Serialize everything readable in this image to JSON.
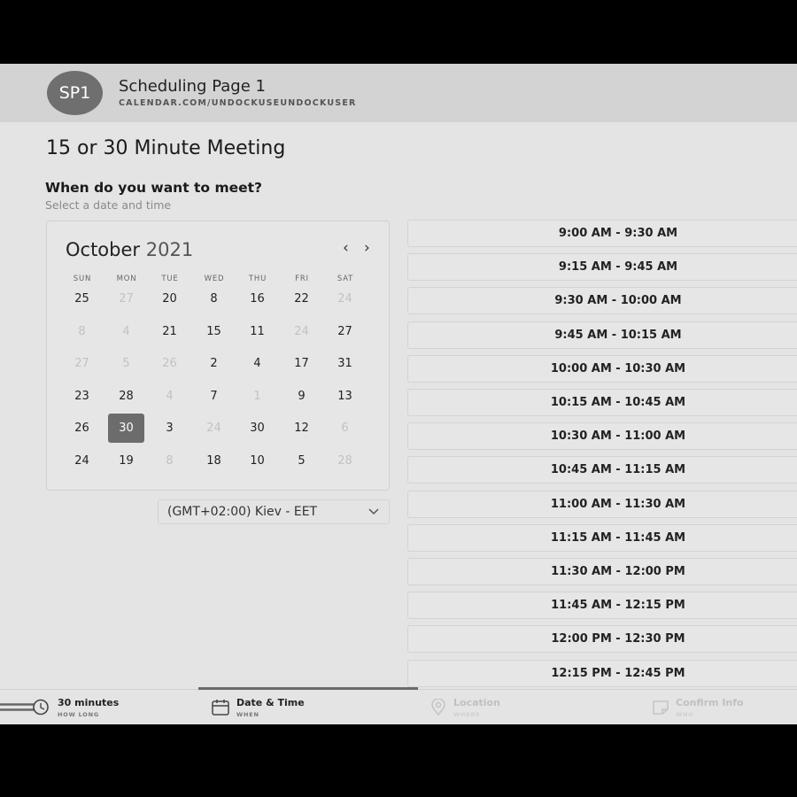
{
  "header": {
    "avatar_initials": "SP1",
    "page_name": "Scheduling Page 1",
    "page_url": "CALENDAR.COM/UNDOCKUSEUNDOCKUSER"
  },
  "meeting": {
    "title": "15 or 30 Minute Meeting",
    "question": "When do you want to meet?",
    "hint": "Select a date and time"
  },
  "calendar": {
    "month": "October",
    "year": "2021",
    "prev_icon": "‹",
    "next_icon": "›",
    "weekdays": [
      "SUN",
      "MON",
      "TUE",
      "WED",
      "THU",
      "FRI",
      "SAT"
    ],
    "weeks": [
      [
        {
          "d": "25"
        },
        {
          "d": "27",
          "muted": true
        },
        {
          "d": "20"
        },
        {
          "d": "8"
        },
        {
          "d": "16"
        },
        {
          "d": "22"
        },
        {
          "d": "24",
          "muted": true
        }
      ],
      [
        {
          "d": "8",
          "muted": true
        },
        {
          "d": "4",
          "muted": true
        },
        {
          "d": "21"
        },
        {
          "d": "15"
        },
        {
          "d": "11"
        },
        {
          "d": "24",
          "muted": true
        },
        {
          "d": "27"
        }
      ],
      [
        {
          "d": "27",
          "muted": true
        },
        {
          "d": "5",
          "muted": true
        },
        {
          "d": "26",
          "muted": true
        },
        {
          "d": "2"
        },
        {
          "d": "4"
        },
        {
          "d": "17"
        },
        {
          "d": "31"
        }
      ],
      [
        {
          "d": "23"
        },
        {
          "d": "28"
        },
        {
          "d": "4",
          "muted": true
        },
        {
          "d": "7"
        },
        {
          "d": "1",
          "muted": true
        },
        {
          "d": "9"
        },
        {
          "d": "13"
        }
      ],
      [
        {
          "d": "26"
        },
        {
          "d": "30",
          "selected": true
        },
        {
          "d": "3"
        },
        {
          "d": "24",
          "muted": true
        },
        {
          "d": "30"
        },
        {
          "d": "12"
        },
        {
          "d": "6",
          "muted": true
        }
      ],
      [
        {
          "d": "24"
        },
        {
          "d": "19"
        },
        {
          "d": "8",
          "muted": true
        },
        {
          "d": "18"
        },
        {
          "d": "10"
        },
        {
          "d": "5"
        },
        {
          "d": "28",
          "muted": true
        }
      ]
    ]
  },
  "timezone": {
    "label": "(GMT+02:00) Kiev - EET",
    "icon": "chevron-down-icon"
  },
  "time_slots": [
    "9:00 AM - 9:30 AM",
    "9:15 AM - 9:45 AM",
    "9:30 AM - 10:00 AM",
    "9:45 AM - 10:15 AM",
    "10:00 AM - 10:30 AM",
    "10:15 AM - 10:45 AM",
    "10:30 AM - 11:00 AM",
    "10:45 AM - 11:15 AM",
    "11:00 AM - 11:30 AM",
    "11:15 AM - 11:45 AM",
    "11:30 AM - 12:00 PM",
    "11:45 AM - 12:15 PM",
    "12:00 PM - 12:30 PM",
    "12:15 PM - 12:45 PM"
  ],
  "steps": [
    {
      "label": "30 minutes",
      "sub": "HOW LONG",
      "icon": "clock-icon",
      "state": "done"
    },
    {
      "label": "Date & Time",
      "sub": "WHEN",
      "icon": "calendar-icon",
      "state": "active"
    },
    {
      "label": "Location",
      "sub": "WHERE",
      "icon": "location-pin-icon",
      "state": "disabled"
    },
    {
      "label": "Confirm Info",
      "sub": "WHO",
      "icon": "note-icon",
      "state": "disabled"
    }
  ],
  "colors": {
    "frame": "#000000",
    "background": "#e4e4e4",
    "header": "#d3d3d3",
    "selected_day": "#6c6c6c",
    "avatar": "#6f6f6f"
  }
}
